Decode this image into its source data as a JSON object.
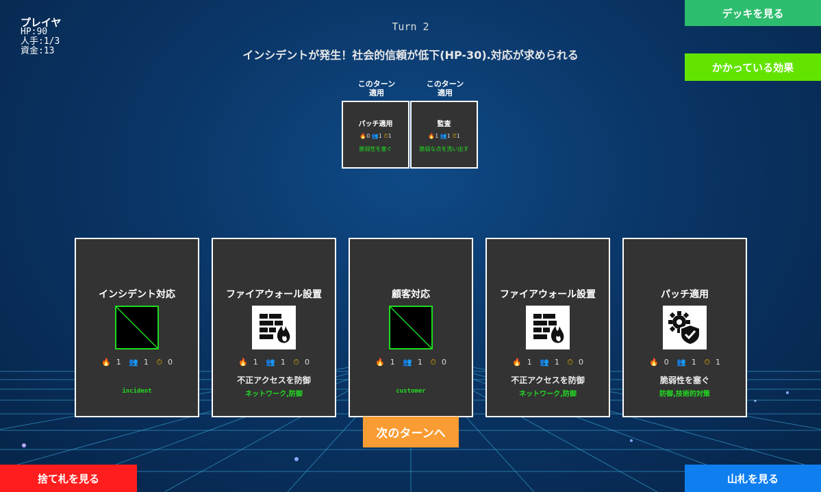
{
  "player": {
    "name": "プレイヤ",
    "hp": "HP:90",
    "workers": "人手:1/3",
    "funds": "資金:13"
  },
  "turn": "Turn 2",
  "event": "インシデントが発生！社会的信頼が低下(HP-30).対応が求められる",
  "buttons": {
    "view_deck": "デッキを見る",
    "active_effects": "かかっている効果",
    "view_discard": "捨て札を見る",
    "view_draw_pile": "山札を見る",
    "next_turn": "次のターンへ"
  },
  "applied": [
    {
      "label_line1": "このターン",
      "label_line2": "適用",
      "title": "パッチ適用",
      "cost": "0",
      "workers": "1",
      "time": "1",
      "desc": "脆弱性を塞ぐ"
    },
    {
      "label_line1": "このターン",
      "label_line2": "適用",
      "title": "監査",
      "cost": "1",
      "workers": "1",
      "time": "1",
      "desc": "脆弱な点を洗い出す"
    }
  ],
  "hand": [
    {
      "title": "インシデント対応",
      "icon": "placeholder-image-icon",
      "cost": "1",
      "workers": "1",
      "time": "0",
      "desc": "",
      "tags": "incident"
    },
    {
      "title": "ファイアウォール設置",
      "icon": "firewall-icon",
      "cost": "1",
      "workers": "1",
      "time": "0",
      "desc": "不正アクセスを防御",
      "tags": "ネットワーク,防御"
    },
    {
      "title": "顧客対応",
      "icon": "placeholder-image-icon",
      "cost": "1",
      "workers": "1",
      "time": "0",
      "desc": "",
      "tags": "customer"
    },
    {
      "title": "ファイアウォール設置",
      "icon": "firewall-icon",
      "cost": "1",
      "workers": "1",
      "time": "0",
      "desc": "不正アクセスを防御",
      "tags": "ネットワーク,防御"
    },
    {
      "title": "パッチ適用",
      "icon": "gear-shield-icon",
      "cost": "0",
      "workers": "1",
      "time": "1",
      "desc": "脆弱性を塞ぐ",
      "tags": "防御,技術的対策"
    }
  ],
  "colors": {
    "deck_button": "#2dbd6e",
    "effects_button": "#63e400",
    "discard_button": "#ff1d1d",
    "draw_button": "#0f7ff0",
    "next_button": "#f99c33",
    "card_bg": "#333333",
    "tag_green": "#22dd22"
  }
}
